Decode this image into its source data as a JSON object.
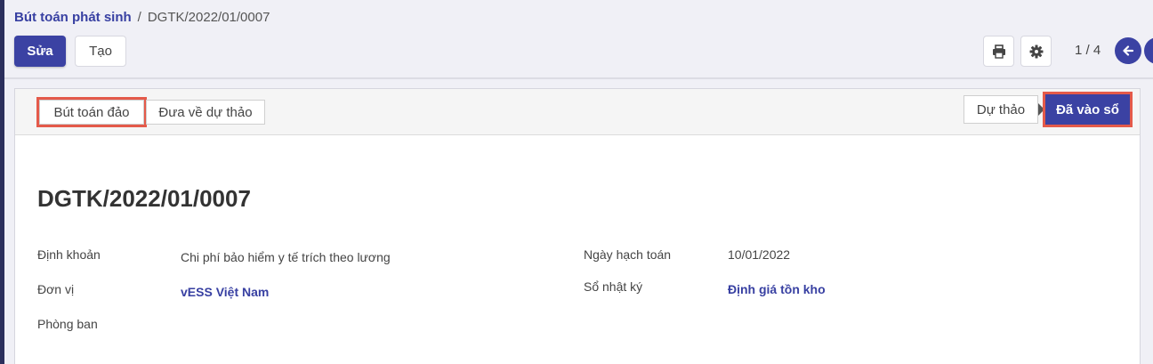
{
  "breadcrumb": {
    "parent": "Bút toán phát sinh",
    "separator": "/",
    "current": "DGTK/2022/01/0007"
  },
  "toolbar": {
    "edit_label": "Sửa",
    "create_label": "Tạo",
    "print_icon": "print-icon",
    "settings_icon": "gear-icon",
    "pager": "1 / 4"
  },
  "statusbar": {
    "reverse_label": "Bút toán đảo",
    "reset_label": "Đưa về dự thảo",
    "stages": {
      "draft": "Dự thảo",
      "posted": "Đã vào sổ"
    },
    "active_stage": "posted"
  },
  "record": {
    "title": "DGTK/2022/01/0007",
    "fields": {
      "account_label": "Định khoản",
      "account_value": "Chi phí bảo hiểm y tế trích theo lương",
      "unit_label": "Đơn vị",
      "unit_value": "vESS Việt Nam",
      "department_label": "Phòng ban",
      "date_label": "Ngày hạch toán",
      "date_value": "10/01/2022",
      "journal_label": "Sổ nhật ký",
      "journal_value": "Định giá tồn kho"
    }
  },
  "colors": {
    "primary": "#3b42a3",
    "highlight": "#e45a4a",
    "link": "#3840a2"
  }
}
